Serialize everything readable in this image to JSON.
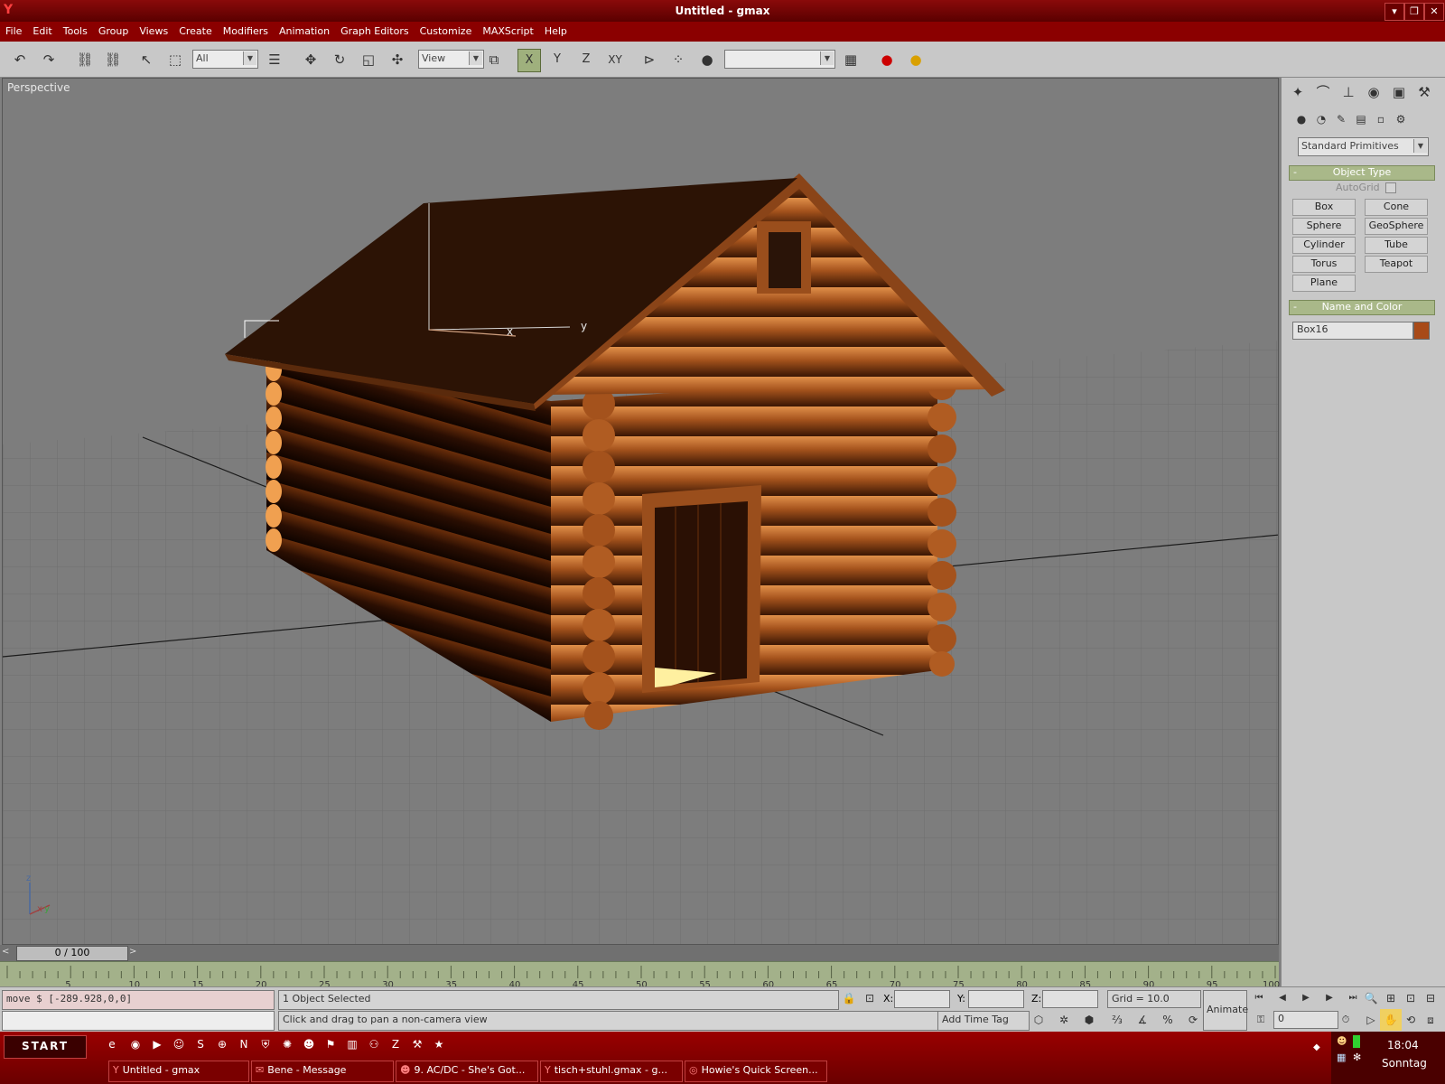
{
  "window": {
    "title": "Untitled - gmax"
  },
  "menu": [
    "File",
    "Edit",
    "Tools",
    "Group",
    "Views",
    "Create",
    "Modifiers",
    "Animation",
    "Graph Editors",
    "Customize",
    "MAXScript",
    "Help"
  ],
  "toolbar": {
    "selection_filter": "All",
    "coord_system": "View",
    "named_selection": "",
    "axis_x": "X",
    "axis_y": "Y",
    "axis_z": "Z",
    "axis_xy": "XY"
  },
  "viewport": {
    "label": "Perspective",
    "axis_x": "x",
    "axis_y": "y",
    "gizmo_z": "z",
    "gizmo_x": "x",
    "gizmo_y": "y"
  },
  "command_panel": {
    "category": "Standard Primitives",
    "object_type_header": "Object Type",
    "autogrid": "AutoGrid",
    "buttons": [
      "Box",
      "Cone",
      "Sphere",
      "GeoSphere",
      "Cylinder",
      "Tube",
      "Torus",
      "Teapot",
      "Plane"
    ],
    "name_color_header": "Name and Color",
    "object_name": "Box16",
    "object_color": "#a84a18"
  },
  "timeline": {
    "thumb": "0 / 100",
    "ticks": [
      "5",
      "10",
      "15",
      "20",
      "25",
      "30",
      "35",
      "40",
      "45",
      "50",
      "55",
      "60",
      "65",
      "70",
      "75",
      "80",
      "85",
      "90",
      "95",
      "100"
    ]
  },
  "status": {
    "maxscript_listener": "move $ [-289.928,0,0]",
    "selection": "1 Object Selected",
    "prompt": "Click and drag to pan a non-camera view",
    "x_label": "X:",
    "y_label": "Y:",
    "z_label": "Z:",
    "grid": "Grid = 10.0",
    "add_time_tag": "Add Time Tag",
    "animate": "Animate",
    "frame": "0"
  },
  "taskbar": {
    "start": "START",
    "tasks": [
      "Untitled - gmax",
      "Bene - Message",
      "9. AC/DC - She's Got...",
      "tisch+stuhl.gmax - g...",
      "Howie's Quick Screen..."
    ],
    "time": "18:04",
    "day": "Sonntag"
  },
  "colors": {
    "titlebar": "#7a0000",
    "menubar": "#8b0000",
    "trackbar": "#a3b18a",
    "rollout_header": "#a9b889",
    "log_wood": "#b8642a"
  }
}
